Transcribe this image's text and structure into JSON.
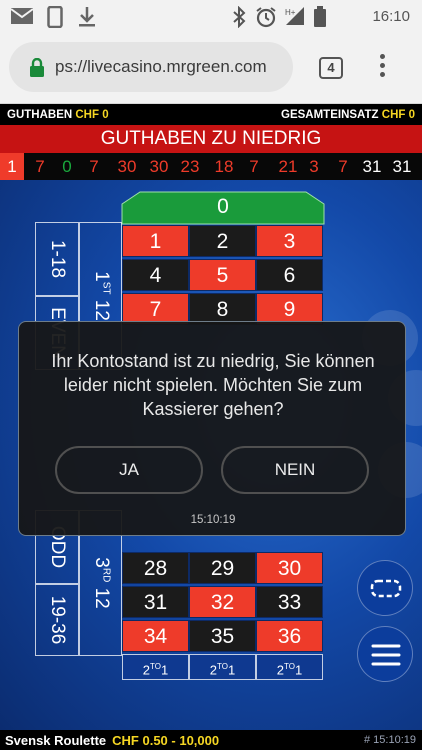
{
  "status_bar": {
    "time": "16:10",
    "left_icons": [
      "mail-icon",
      "phone-icon",
      "download-icon"
    ],
    "right_icons": [
      "bluetooth-icon",
      "alarm-icon",
      "signal-icon",
      "battery-icon"
    ]
  },
  "browser": {
    "url": "ps://livecasino.mrgreen.com",
    "tab_count": "4"
  },
  "balance": {
    "credit_label": "GUTHABEN",
    "credit_value": "CHF 0",
    "total_bet_label": "GESAMTEINSATZ",
    "total_bet_value": "CHF 0"
  },
  "banner": {
    "text": "GUTHABEN ZU NIEDRIG"
  },
  "history": [
    {
      "n": "1",
      "c": "first"
    },
    {
      "n": "7",
      "c": "red"
    },
    {
      "n": "0",
      "c": "green"
    },
    {
      "n": "7",
      "c": "red"
    },
    {
      "n": "30",
      "c": "red"
    },
    {
      "n": "30",
      "c": "red"
    },
    {
      "n": "23",
      "c": "red"
    },
    {
      "n": "18",
      "c": "red"
    },
    {
      "n": "7",
      "c": "red"
    },
    {
      "n": "21",
      "c": "red"
    },
    {
      "n": "3",
      "c": "red"
    },
    {
      "n": "7",
      "c": "red"
    },
    {
      "n": "31",
      "c": "black"
    },
    {
      "n": "31",
      "c": "black"
    }
  ],
  "table": {
    "zero": "0",
    "outside_bets": {
      "low": "1-18",
      "even": "EVEN",
      "odd": "ODD",
      "high": "19-36"
    },
    "dozens": {
      "first_num": "1",
      "first_suffix": "ST",
      "first_value": "12",
      "third_num": "3",
      "third_suffix": "RD",
      "third_value": "12"
    },
    "rows_top": [
      [
        {
          "n": "1",
          "c": "r"
        },
        {
          "n": "2",
          "c": "b"
        },
        {
          "n": "3",
          "c": "r"
        }
      ],
      [
        {
          "n": "4",
          "c": "b"
        },
        {
          "n": "5",
          "c": "r"
        },
        {
          "n": "6",
          "c": "b"
        }
      ],
      [
        {
          "n": "7",
          "c": "r"
        },
        {
          "n": "8",
          "c": "b"
        },
        {
          "n": "9",
          "c": "r"
        }
      ]
    ],
    "rows_bottom": [
      [
        {
          "n": "28",
          "c": "b"
        },
        {
          "n": "29",
          "c": "b"
        },
        {
          "n": "30",
          "c": "r"
        }
      ],
      [
        {
          "n": "31",
          "c": "b"
        },
        {
          "n": "32",
          "c": "r"
        },
        {
          "n": "33",
          "c": "b"
        }
      ],
      [
        {
          "n": "34",
          "c": "r"
        },
        {
          "n": "35",
          "c": "b"
        },
        {
          "n": "36",
          "c": "r"
        }
      ]
    ],
    "two_to_one": {
      "a": "2",
      "sup": "TO",
      "b": "1"
    }
  },
  "modal": {
    "message": "Ihr Kontostand ist zu niedrig, Sie können leider nicht spielen. Möchten Sie zum Kassierer gehen?",
    "yes_label": "JA",
    "no_label": "NEIN",
    "timestamp": "15:10:19"
  },
  "footer": {
    "game_name": "Svensk Roulette",
    "limits": "CHF 0.50 - 10,000",
    "round": "# 15:10:19"
  },
  "colors": {
    "red": "#ee3b2a",
    "black": "#1b1b1b",
    "green": "#19a83c",
    "accent_yellow": "#f5d623",
    "table_blue": "#1349a8"
  }
}
